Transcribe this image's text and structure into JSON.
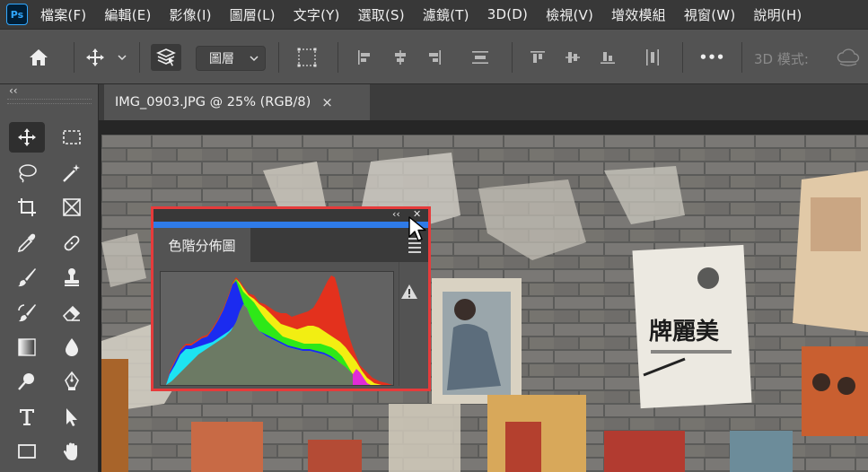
{
  "app": {
    "logo": "Ps"
  },
  "menu": [
    "檔案(F)",
    "編輯(E)",
    "影像(I)",
    "圖層(L)",
    "文字(Y)",
    "選取(S)",
    "濾鏡(T)",
    "3D(D)",
    "檢視(V)",
    "增效模組",
    "視窗(W)",
    "說明(H)"
  ],
  "options_bar": {
    "layer_select_value": "圖層",
    "more_label": "•••",
    "mode_label": "3D 模式:"
  },
  "toolbar": {
    "collapse_label": "‹‹"
  },
  "document": {
    "tab_title": "IMG_0903.JPG @ 25% (RGB/8)",
    "close_label": "×"
  },
  "histogram_panel": {
    "tab_label": "色階分佈圖",
    "collapse_label": "‹‹",
    "close_label": "✕",
    "warning_icon": "warning-icon"
  },
  "colors": {
    "accent_blue": "#2f7be8",
    "highlight_red": "#e63b3b",
    "panel_bg": "#535353",
    "menu_bg": "#383838"
  }
}
